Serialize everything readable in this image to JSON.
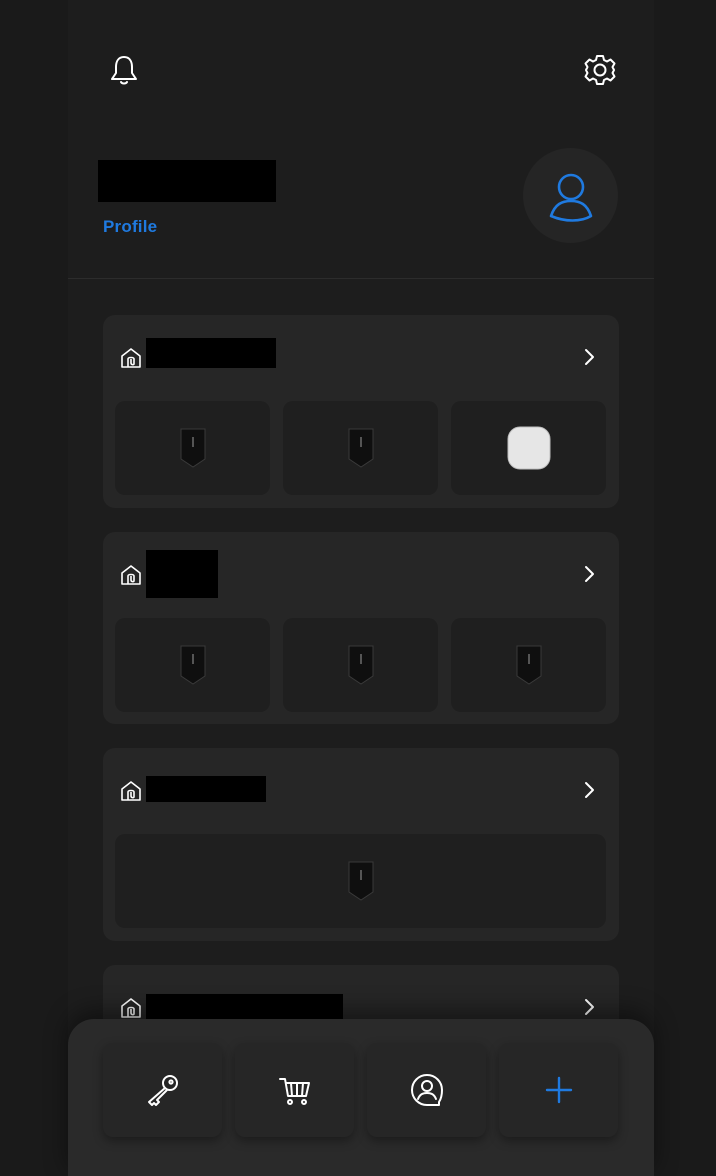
{
  "header": {
    "notifications_icon": "bell-icon",
    "settings_icon": "gear-icon"
  },
  "profile": {
    "link_label": "Profile",
    "avatar_icon": "user-icon",
    "accent_color": "#1f7ae0"
  },
  "sites": [
    {
      "icon": "home-icon",
      "devices": [
        "charger",
        "charger",
        "hub"
      ]
    },
    {
      "icon": "home-icon",
      "devices": [
        "charger",
        "charger",
        "charger"
      ]
    },
    {
      "icon": "home-icon",
      "devices": [
        "charger"
      ]
    },
    {
      "icon": "home-icon",
      "devices": []
    }
  ],
  "bottom_nav": {
    "items": [
      {
        "icon": "wrench-icon"
      },
      {
        "icon": "cart-icon"
      },
      {
        "icon": "support-icon"
      },
      {
        "icon": "plus-icon"
      }
    ]
  }
}
